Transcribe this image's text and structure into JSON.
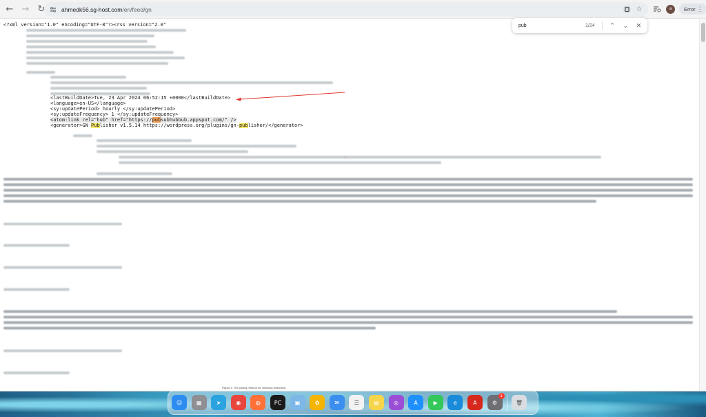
{
  "browser": {
    "url_host": "ahmedk56.sg-host.com",
    "url_path": "/en/feed/gn",
    "profile_initial": "a",
    "error_label": "Error"
  },
  "find": {
    "query": "pub",
    "count": "1/24"
  },
  "xml": {
    "declaration": "<?xml version=\"1.0\" encoding=\"UTF-8\"?><rss version=\"2.0\"",
    "channel_open": "<channel>",
    "lastBuildDate": "<lastBuildDate>Tue, 23 Apr 2024 06:52:15 +0000</lastBuildDate>",
    "language": "<language>en-US</language>",
    "updatePeriod": "<sy:updatePeriod> hourly </sy:updatePeriod>",
    "updateFrequency": "<sy:updateFrequency> 1 </sy:updateFrequency>",
    "atom_pre": "<atom:link rel=\"hub\" href=\"https://",
    "atom_match": "pub",
    "atom_post": "subhubbub.appspot.com/\" />",
    "gen_pre": "<generator>GN ",
    "gen_match1": "Pub",
    "gen_mid": "lisher v1.5.14 https://wordpress.org/plugins/gn-",
    "gen_match2": "pub",
    "gen_post": "lisher/</generator>",
    "item_open": "<item>",
    "h2_1": "<h2 class=\"wp-block-heading\">Number 1</h2>",
    "p_1": "<p>This is testing.</p>",
    "h2_2": "<h2 class=\"wp-block-heading\">Number 2</h2>",
    "p_2": "<p>This is testing.</p>",
    "h2_3": "<h2 class=\"wp-block-heading\">Number 3</h2>",
    "p_3": "<p>This is testing.</p>"
  },
  "caption": "Figure 1: The polling method for checking freshness.",
  "dock": {
    "apps": [
      {
        "name": "Finder",
        "color": "#2d8cf0",
        "glyph": "☺"
      },
      {
        "name": "Launchpad",
        "color": "#8e8e93",
        "glyph": "▦"
      },
      {
        "name": "Telegram",
        "color": "#2aa3e0",
        "glyph": "➤"
      },
      {
        "name": "Chrome",
        "color": "#e8453c",
        "glyph": "◉"
      },
      {
        "name": "Firefox",
        "color": "#ff7139",
        "glyph": "◍"
      },
      {
        "name": "PyCharm",
        "color": "#1b1b1b",
        "glyph": "PC"
      },
      {
        "name": "Preview",
        "color": "#7cb7e8",
        "glyph": "▣"
      },
      {
        "name": "Photos",
        "color": "#f4b400",
        "glyph": "✿"
      },
      {
        "name": "Mail",
        "color": "#3b8ef0",
        "glyph": "✉"
      },
      {
        "name": "Reminders",
        "color": "#f2f2f2",
        "glyph": "☰"
      },
      {
        "name": "Notes",
        "color": "#f7d54a",
        "glyph": "▤"
      },
      {
        "name": "Podcasts",
        "color": "#9b4dd6",
        "glyph": "◎"
      },
      {
        "name": "App Store",
        "color": "#1e90ff",
        "glyph": "A"
      },
      {
        "name": "FaceTime",
        "color": "#34c759",
        "glyph": "▶"
      },
      {
        "name": "Edge",
        "color": "#1a8bd8",
        "glyph": "e"
      },
      {
        "name": "Acrobat",
        "color": "#d7281e",
        "glyph": "A"
      },
      {
        "name": "System Settings",
        "color": "#6e6e73",
        "glyph": "⚙",
        "badge": "1"
      },
      {
        "name": "Trash",
        "color": "#d9dde1",
        "glyph": "🗑"
      }
    ]
  }
}
